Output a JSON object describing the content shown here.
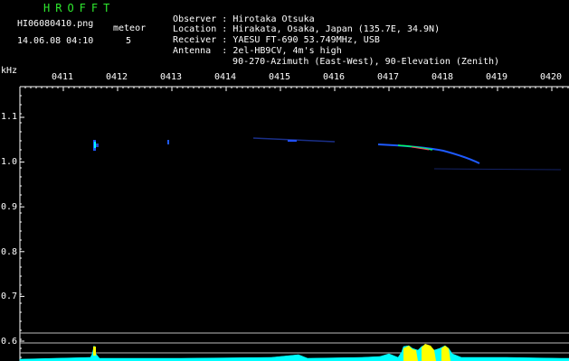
{
  "header": {
    "app_title": "HROFFT",
    "filename": "HI06080410.png",
    "meteor_label": "meteor",
    "datetime": "14.06.08 04:10",
    "meteor_count": "5",
    "info_rows": [
      {
        "key": "Observer",
        "sep": ":",
        "value": "Hirotaka Otsuka"
      },
      {
        "key": "Location",
        "sep": ":",
        "value": "Hirakata, Osaka, Japan (135.7E, 34.9N)"
      },
      {
        "key": "Receiver",
        "sep": ":",
        "value": "YAESU FT-690 53.749MHz, USB"
      },
      {
        "key": "Antenna ",
        "sep": ":",
        "value": "2el-HB9CV, 4m's high"
      },
      {
        "key": "",
        "sep": "",
        "value": "90-270-Azimuth (East-West), 90-Elevation (Zenith)"
      }
    ]
  },
  "plot": {
    "y_unit": "kHz",
    "x_ticks": [
      "0411",
      "0412",
      "0413",
      "0414",
      "0415",
      "0416",
      "0417",
      "0418",
      "0419",
      "0420"
    ],
    "y_ticks": [
      "1.1",
      "1.0",
      "0.9",
      "0.8",
      "0.7",
      "0.6"
    ],
    "colors": {
      "axis": "#ffffff",
      "tick": "#ffffff",
      "signal_cyan": "#00ffff",
      "signal_yellow": "#ffff00",
      "trace_blue": "#1e5aff",
      "trace_green": "#00ff66"
    }
  }
}
